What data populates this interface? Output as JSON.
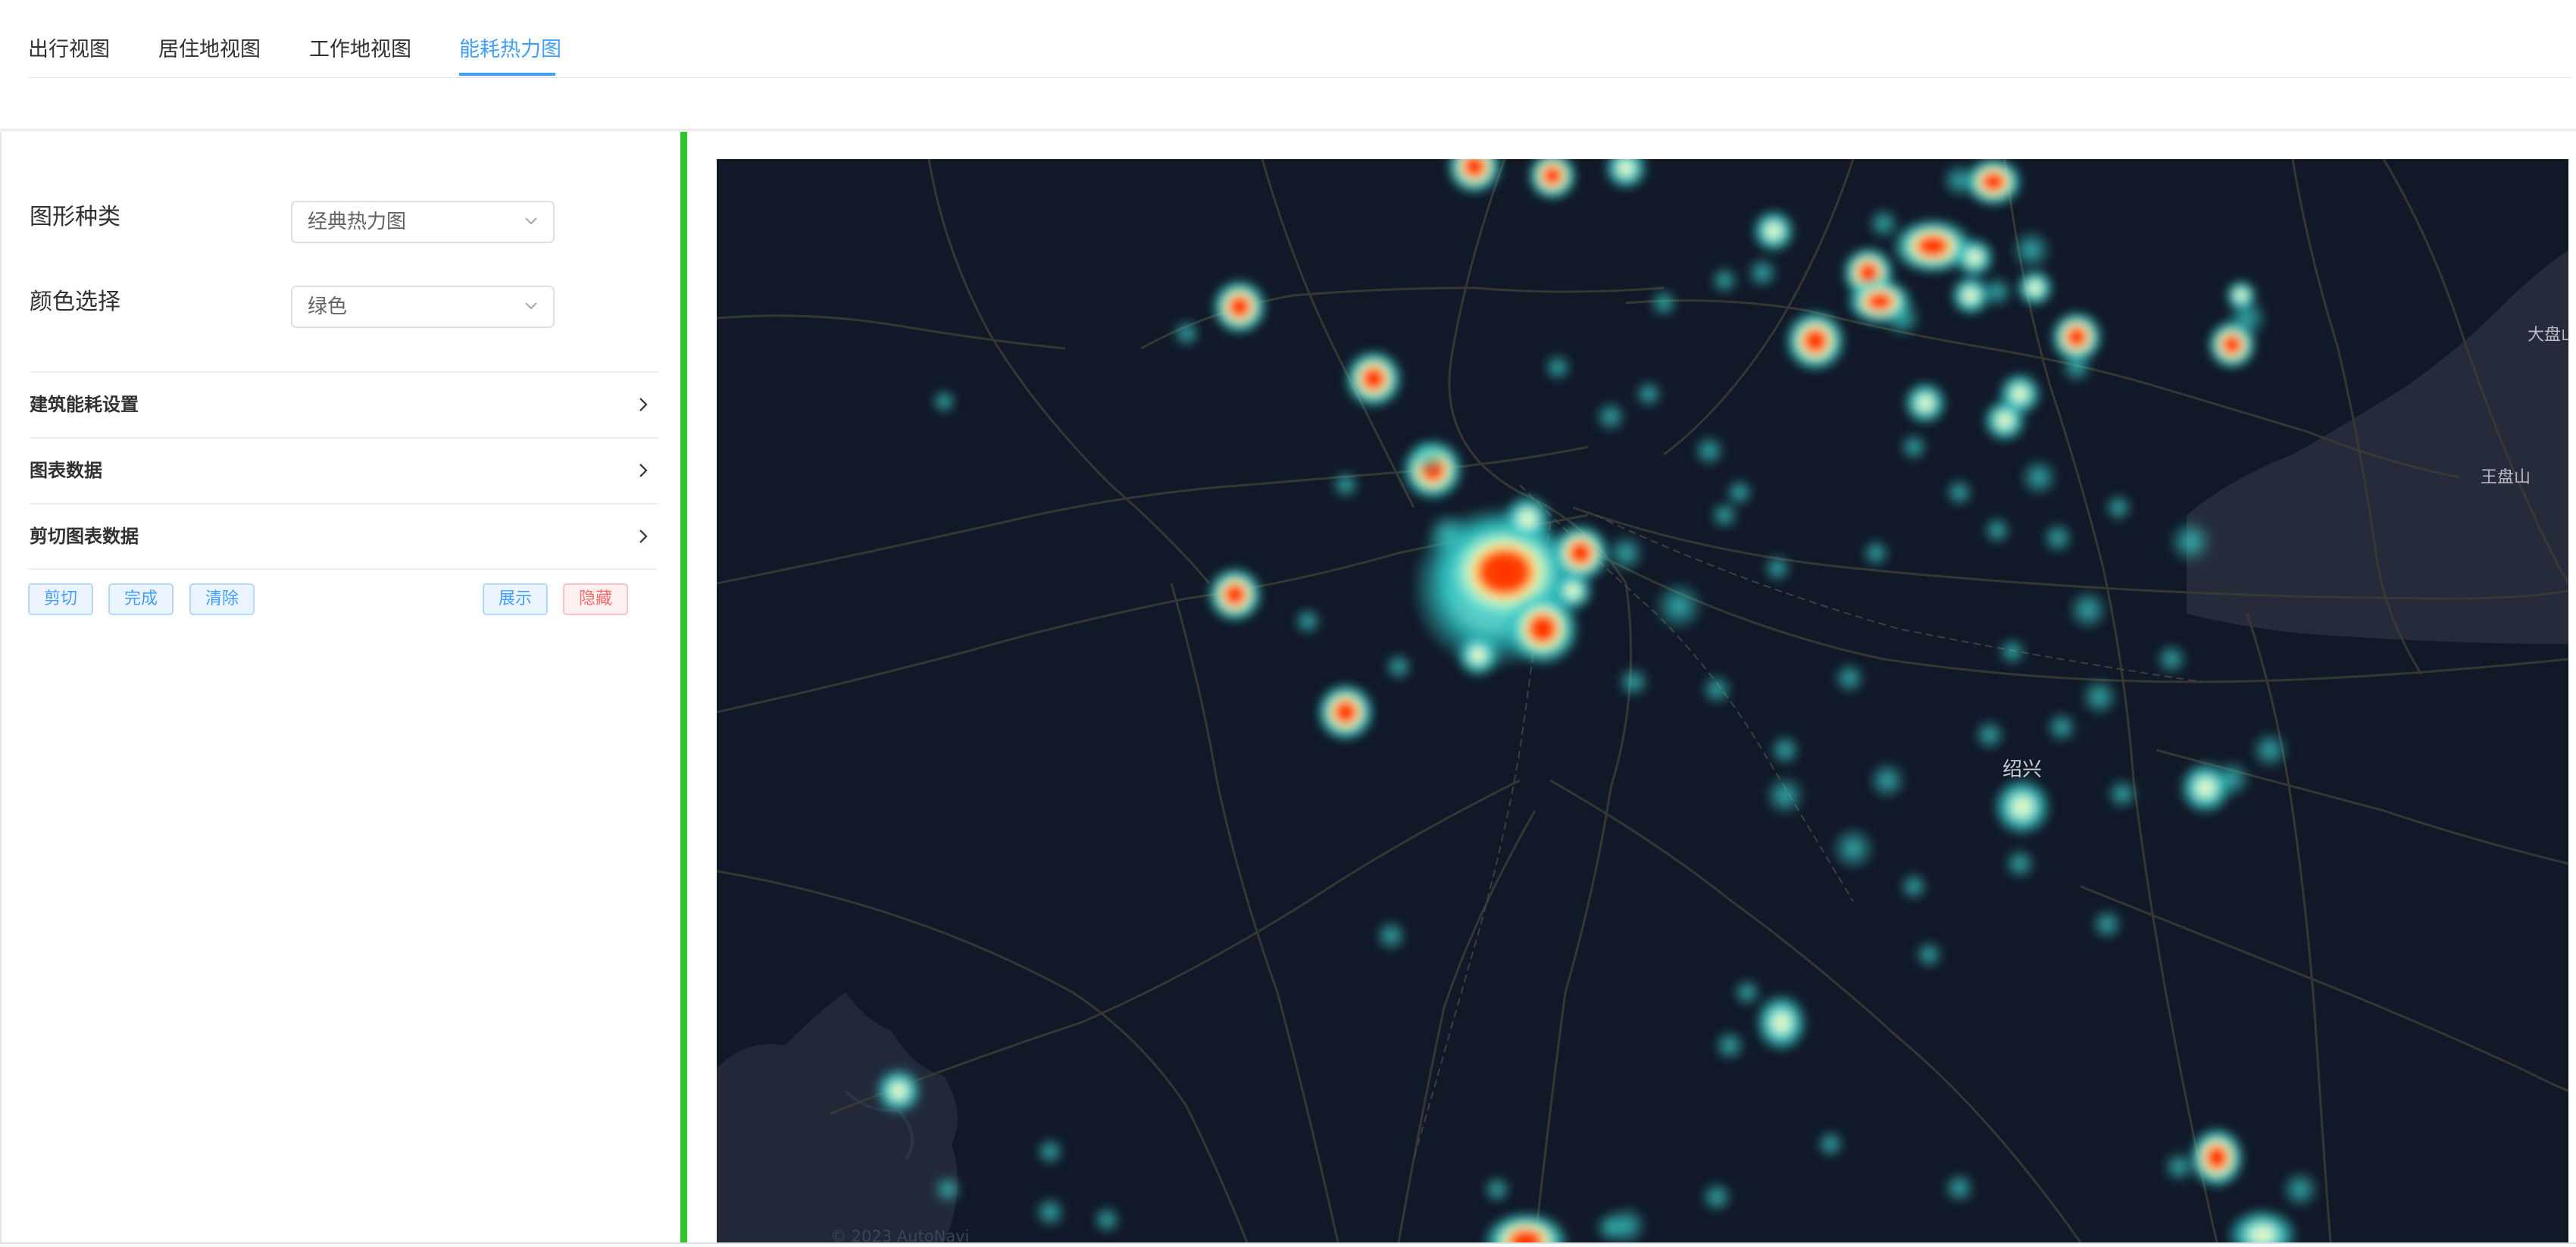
{
  "tabs": [
    {
      "label": "出行视图",
      "active": false
    },
    {
      "label": "居住地视图",
      "active": false
    },
    {
      "label": "工作地视图",
      "active": false
    },
    {
      "label": "能耗热力图",
      "active": true
    }
  ],
  "form": {
    "chart_type": {
      "label": "图形种类",
      "value": "经典热力图"
    },
    "color": {
      "label": "颜色选择",
      "value": "绿色"
    }
  },
  "collapse": [
    {
      "label": "建筑能耗设置"
    },
    {
      "label": "图表数据"
    },
    {
      "label": "剪切图表数据"
    }
  ],
  "buttons": {
    "cut": "剪切",
    "done": "完成",
    "clear": "清除",
    "show": "展示",
    "hide": "隐藏"
  },
  "map": {
    "labels": {
      "city": "绍兴",
      "mountain1": "大盘山",
      "mountain2": "王盘山"
    },
    "copyright": "© 2023 AutoNavi"
  },
  "colors": {
    "accent": "#409eff",
    "divider": "#2fc52b",
    "map_bg": "#111827",
    "danger": "#f56c6c"
  }
}
